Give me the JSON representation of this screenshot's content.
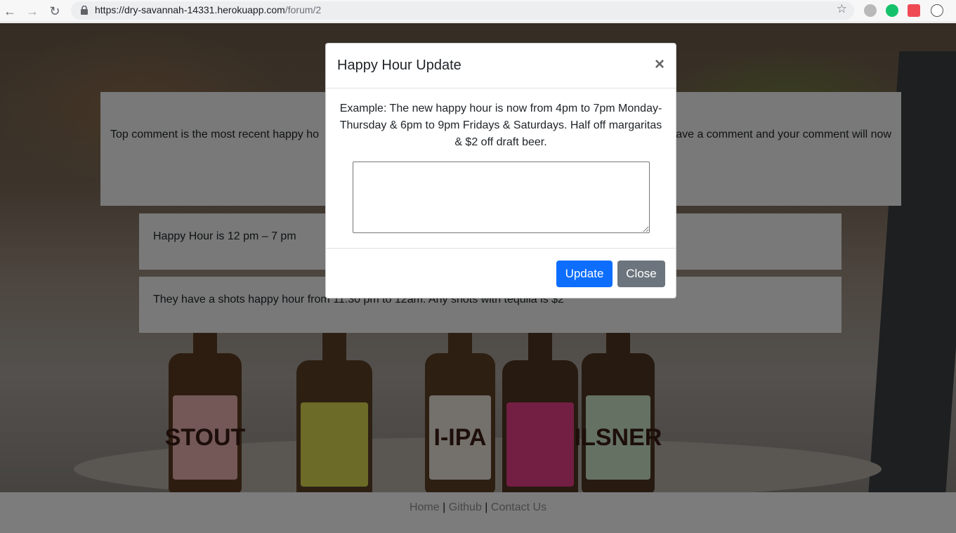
{
  "browser": {
    "url_host": "https://dry-savannah-14331.herokuapp.com",
    "url_path": "/forum/2",
    "back_icon": "←",
    "forward_icon": "→",
    "reload_icon": "↻",
    "star_icon": "☆"
  },
  "page": {
    "intro_left": "Top comment is the most recent happy ho",
    "intro_right": "ave a comment and your comment will now",
    "comments": [
      {
        "text": "Happy Hour is 12 pm – 7 pm"
      },
      {
        "text": "They have a shots happy hour from 11:30 pm to 12am. Any shots with tequila is $2"
      }
    ],
    "bottle_labels": [
      "STOUT",
      "I-IPA",
      "ILSNER"
    ]
  },
  "modal": {
    "title": "Happy Hour Update",
    "close_symbol": "×",
    "example_text": "Example: The new happy hour is now from 4pm to 7pm Monday-Thursday & 6pm to 9pm Fridays & Saturdays. Half off margaritas & $2 off draft beer.",
    "textarea_value": "",
    "update_label": "Update",
    "close_label": "Close"
  },
  "footer": {
    "home": "Home",
    "github": "Github",
    "contact": "Contact Us",
    "separator": "|"
  },
  "colors": {
    "primary": "#0d6efd",
    "secondary": "#6c757d"
  }
}
